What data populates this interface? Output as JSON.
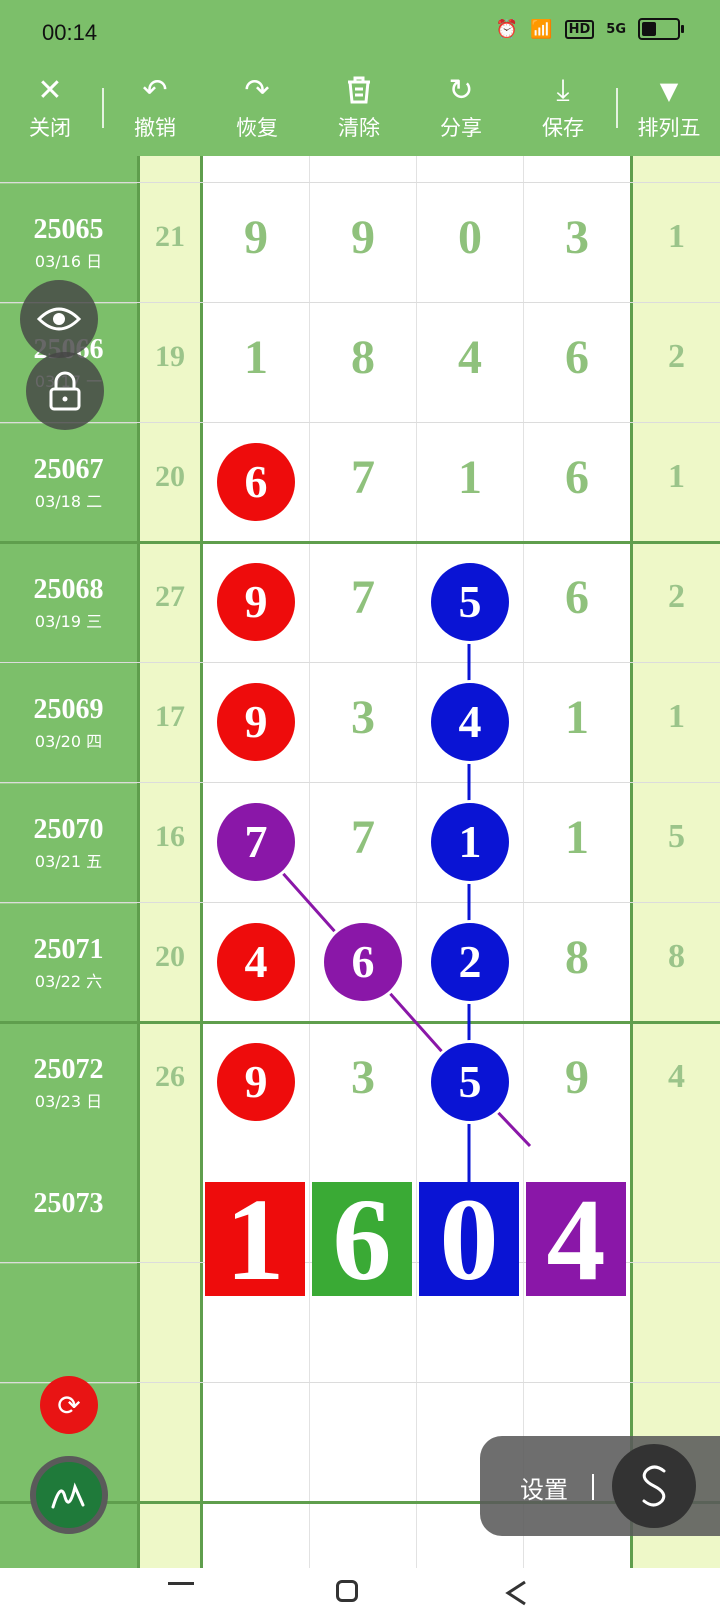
{
  "status": {
    "time": "00:14",
    "hd": "HD",
    "net": "5G"
  },
  "toolbar": {
    "close": "关闭",
    "undo": "撤销",
    "redo": "恢复",
    "clear": "清除",
    "share": "分享",
    "save": "保存",
    "layout": "排列五"
  },
  "rows": [
    {
      "issue": "25065",
      "date": "03/16 日",
      "sum": "21",
      "digits": [
        "9",
        "9",
        "0",
        "3"
      ],
      "fifth": "1"
    },
    {
      "issue": "25066",
      "date": "03/17 一",
      "sum": "19",
      "digits": [
        "1",
        "8",
        "4",
        "6"
      ],
      "fifth": "2"
    },
    {
      "issue": "25067",
      "date": "03/18 二",
      "sum": "20",
      "digits": [
        "6",
        "7",
        "1",
        "6"
      ],
      "fifth": "1"
    },
    {
      "issue": "25068",
      "date": "03/19 三",
      "sum": "27",
      "digits": [
        "9",
        "7",
        "5",
        "6"
      ],
      "fifth": "2"
    },
    {
      "issue": "25069",
      "date": "03/20 四",
      "sum": "17",
      "digits": [
        "9",
        "3",
        "4",
        "1"
      ],
      "fifth": "1"
    },
    {
      "issue": "25070",
      "date": "03/21 五",
      "sum": "16",
      "digits": [
        "7",
        "7",
        "1",
        "1"
      ],
      "fifth": "5"
    },
    {
      "issue": "25071",
      "date": "03/22 六",
      "sum": "20",
      "digits": [
        "4",
        "6",
        "2",
        "8"
      ],
      "fifth": "8"
    },
    {
      "issue": "25072",
      "date": "03/23 日",
      "sum": "26",
      "digits": [
        "9",
        "3",
        "5",
        "9"
      ],
      "fifth": "4"
    }
  ],
  "prediction": {
    "issue": "25073",
    "digits": [
      "1",
      "6",
      "0",
      "4"
    ]
  },
  "markers": [
    {
      "row": 2,
      "col": 0,
      "color": "red"
    },
    {
      "row": 3,
      "col": 0,
      "color": "red"
    },
    {
      "row": 3,
      "col": 2,
      "color": "blue"
    },
    {
      "row": 4,
      "col": 0,
      "color": "red"
    },
    {
      "row": 4,
      "col": 2,
      "color": "blue"
    },
    {
      "row": 5,
      "col": 0,
      "color": "purple"
    },
    {
      "row": 5,
      "col": 2,
      "color": "blue"
    },
    {
      "row": 6,
      "col": 0,
      "color": "red"
    },
    {
      "row": 6,
      "col": 1,
      "color": "purple"
    },
    {
      "row": 6,
      "col": 2,
      "color": "blue"
    },
    {
      "row": 7,
      "col": 0,
      "color": "red"
    },
    {
      "row": 7,
      "col": 2,
      "color": "blue"
    }
  ],
  "prediction_colors": [
    "red",
    "green",
    "blue",
    "purple"
  ],
  "colors": {
    "green": "#7cbf6a",
    "red": "#ee0c0c",
    "blue": "#0a14d4",
    "purple": "#8a17a8",
    "pred_green": "#3aaa35"
  },
  "settings": {
    "label": "设置"
  }
}
